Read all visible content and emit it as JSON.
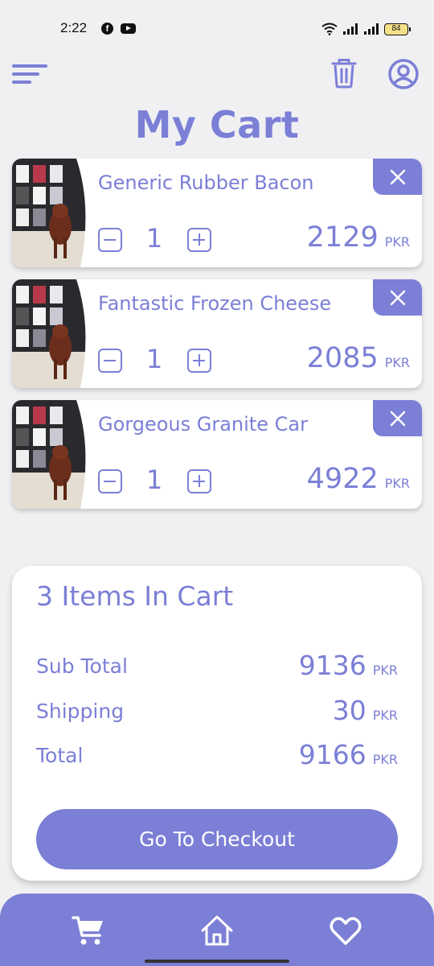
{
  "status_bar": {
    "time": "2:22",
    "battery": "84"
  },
  "header": {
    "title": "My Cart"
  },
  "colors": {
    "accent": "#7b7fd6",
    "background": "#f0f0f2",
    "card": "#ffffff"
  },
  "icons": {
    "menu": "menu-icon",
    "trash": "trash-icon",
    "profile": "profile-icon",
    "remove": "close-icon",
    "decrease": "minus-icon",
    "increase": "plus-icon",
    "cart": "cart-icon",
    "home": "home-icon",
    "favorites": "heart-icon"
  },
  "cart": {
    "items": [
      {
        "name": "Generic Rubber Bacon",
        "quantity": "1",
        "price": "2129",
        "currency": "PKR"
      },
      {
        "name": "Fantastic Frozen Cheese",
        "quantity": "1",
        "price": "2085",
        "currency": "PKR"
      },
      {
        "name": "Gorgeous Granite Car",
        "quantity": "1",
        "price": "4922",
        "currency": "PKR"
      }
    ]
  },
  "summary": {
    "title": "3 Items In Cart",
    "rows": [
      {
        "label": "Sub Total",
        "value": "9136",
        "currency": "PKR"
      },
      {
        "label": "Shipping",
        "value": "30",
        "currency": "PKR"
      },
      {
        "label": "Total",
        "value": "9166",
        "currency": "PKR"
      }
    ],
    "checkout_label": "Go To Checkout"
  }
}
